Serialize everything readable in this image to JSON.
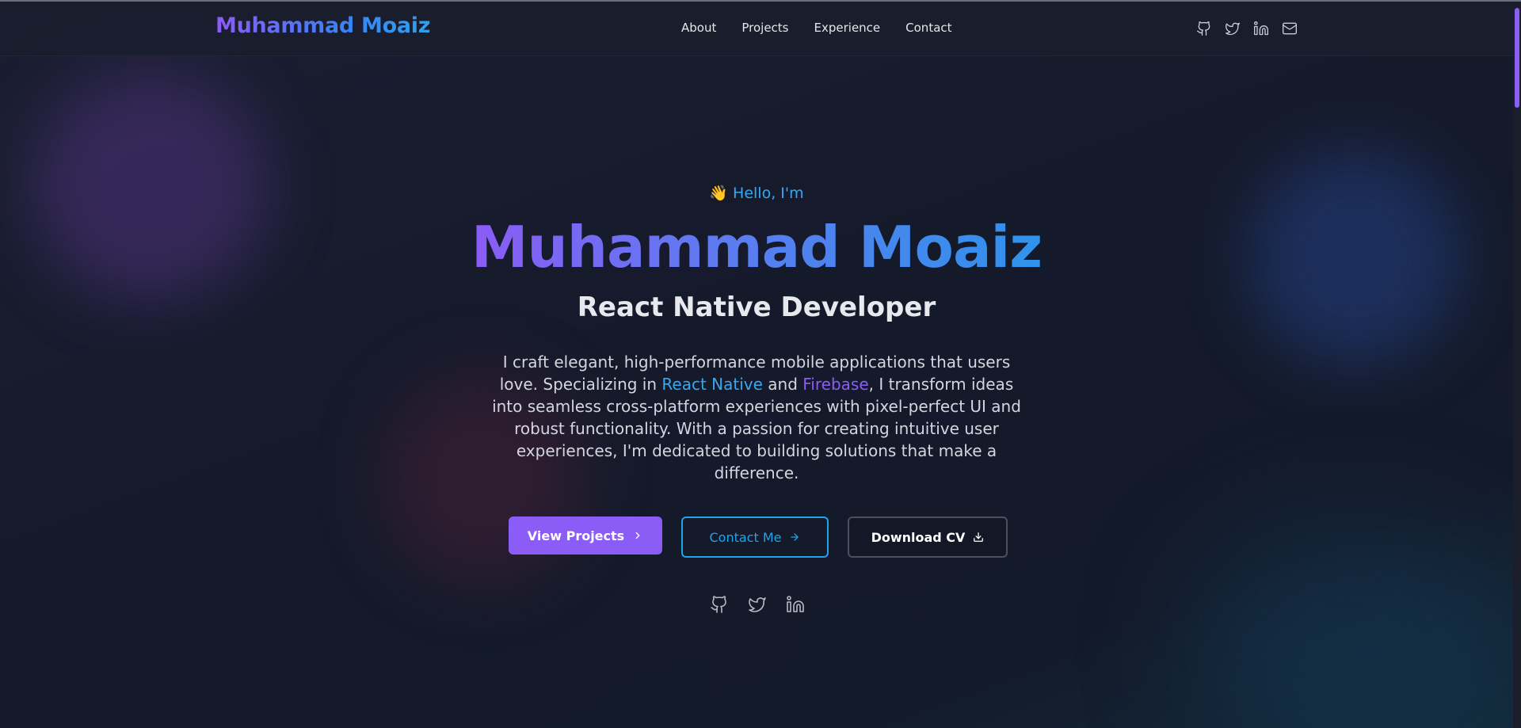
{
  "header": {
    "logo": "Muhammad Moaiz",
    "nav": [
      {
        "label": "About"
      },
      {
        "label": "Projects"
      },
      {
        "label": "Experience"
      },
      {
        "label": "Contact"
      }
    ],
    "icons": [
      "github-icon",
      "twitter-icon",
      "linkedin-icon",
      "mail-icon"
    ]
  },
  "hero": {
    "greeting_emoji": "👋",
    "greeting": "Hello, I'm",
    "name": "Muhammad Moaiz",
    "role": "React Native Developer",
    "bio": {
      "part1": "I craft elegant, high-performance mobile applications that users love. Specializing in ",
      "highlight1": "React Native",
      "part2": " and ",
      "highlight2": "Firebase",
      "part3": ", I transform ideas into seamless cross-platform experiences with pixel-perfect UI and robust functionality. With a passion for creating intuitive user experiences, I'm dedicated to building solutions that make a difference."
    },
    "buttons": {
      "view_projects": "View Projects",
      "contact_me": "Contact Me",
      "download_cv": "Download CV"
    },
    "social_icons": [
      "github-icon",
      "twitter-icon",
      "linkedin-icon"
    ]
  },
  "colors": {
    "accent_purple": "#8b5cf6",
    "accent_blue": "#1fa3ea",
    "background": "#151a2b"
  }
}
